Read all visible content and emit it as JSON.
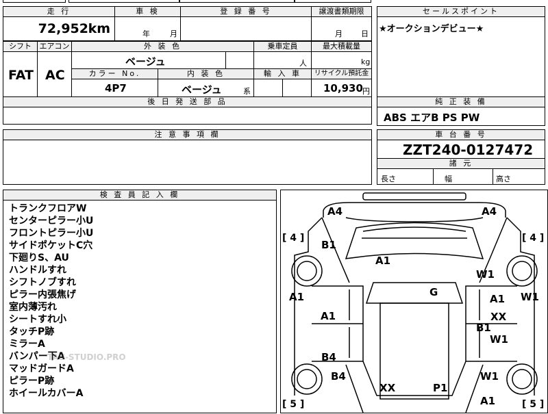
{
  "top_partial": {
    "left_text": "",
    "mid_text": ""
  },
  "row1": {
    "mileage_label": "走 行",
    "mileage_value": "72,952",
    "mileage_unit": "km",
    "inspection_label": "車 検",
    "inspection_year_unit": "年",
    "inspection_month_unit": "月",
    "reg_label": "登 録 番 号",
    "transfer_label": "譲渡書類期限",
    "transfer_month_unit": "月",
    "transfer_day_unit": "日"
  },
  "row2": {
    "shift_label": "シフト",
    "aircon_label": "エアコン",
    "exterior_color_label": "外 装 色",
    "capacity_label": "乗車定員",
    "max_load_label": "最大積載量",
    "shift_value": "FAT",
    "aircon_value": "AC",
    "exterior_color_value": "ベージュ",
    "capacity_unit": "人",
    "max_load_unit": "kg",
    "color_no_label": "カラー No.",
    "interior_color_label": "内 装 色",
    "import_label": "輸 入 車",
    "recycle_label": "リサイクル預託金",
    "color_no_value": "4P7",
    "interior_color_value": "ベージュ",
    "interior_color_suffix": "系",
    "recycle_value": "10,930",
    "recycle_unit": "円"
  },
  "later_parts_label": "後 日 発 送 部 品",
  "sales_point": {
    "label": "セールスポイント",
    "text": "★オークションデビュー★"
  },
  "equipment": {
    "label": "純 正 装 備",
    "text": "ABS エアB PS PW"
  },
  "caution": {
    "label": "注 意 事 項 欄"
  },
  "chassis": {
    "label": "車 台 番 号",
    "value": "ZZT240-0127472"
  },
  "dimensions": {
    "label": "諸 元",
    "length_label": "長さ",
    "width_label": "幅",
    "height_label": "高さ"
  },
  "inspector": {
    "label": "検 査 員 記 入 欄",
    "lines": [
      "トランクフロアW",
      "センターピラー小U",
      "フロントピラー小U",
      "サイドポケットC穴",
      "下廻りS、AU",
      "ハンドルすれ",
      "シフトノブすれ",
      "ピラー内張焦げ",
      "室内薄汚れ",
      "シートすれ小",
      "タッチP跡",
      "ミラーA",
      "バンパー下A",
      "マッドガードA",
      "ピラーP跡",
      "ホイールカバーA"
    ]
  },
  "watermark": "TAU-STUDIO.PRO",
  "diagram": {
    "brackets": [
      "[ 4 ]",
      "[ 4 ]",
      "[ 5 ]",
      "[ 5 ]"
    ],
    "marks": [
      "A4",
      "A4",
      "B1",
      "A1",
      "W1",
      "A1",
      "G",
      "A1",
      "W1",
      "A1",
      "XX",
      "B1",
      "W1",
      "B4",
      "B4",
      "W1",
      "XX",
      "P1",
      "A1"
    ]
  }
}
